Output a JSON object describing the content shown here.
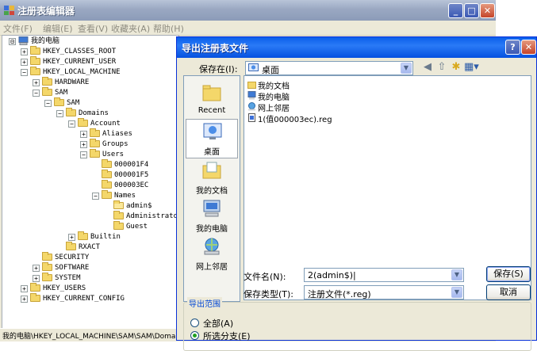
{
  "regedit": {
    "title": "注册表编辑器",
    "menu": [
      "文件(F)",
      "编辑(E)",
      "查看(V)",
      "收藏夹(A)",
      "帮助(H)"
    ],
    "status_path": "我的电脑\\HKEY_LOCAL_MACHINE\\SAM\\SAM\\Domains\\Ac",
    "tree": [
      {
        "label": "我的电脑",
        "depth": 0,
        "toggle": "⊟",
        "icon": "computer-icon"
      },
      {
        "label": "HKEY_CLASSES_ROOT",
        "depth": 1,
        "toggle": "+",
        "icon": "folder-icon"
      },
      {
        "label": "HKEY_CURRENT_USER",
        "depth": 1,
        "toggle": "+",
        "icon": "folder-icon"
      },
      {
        "label": "HKEY_LOCAL_MACHINE",
        "depth": 1,
        "toggle": "−",
        "icon": "folder-icon"
      },
      {
        "label": "HARDWARE",
        "depth": 2,
        "toggle": "+",
        "icon": "folder-icon"
      },
      {
        "label": "SAM",
        "depth": 2,
        "toggle": "−",
        "icon": "folder-icon"
      },
      {
        "label": "SAM",
        "depth": 3,
        "toggle": "−",
        "icon": "folder-icon"
      },
      {
        "label": "Domains",
        "depth": 4,
        "toggle": "−",
        "icon": "folder-icon"
      },
      {
        "label": "Account",
        "depth": 5,
        "toggle": "−",
        "icon": "folder-icon"
      },
      {
        "label": "Aliases",
        "depth": 6,
        "toggle": "+",
        "icon": "folder-icon"
      },
      {
        "label": "Groups",
        "depth": 6,
        "toggle": "+",
        "icon": "folder-icon"
      },
      {
        "label": "Users",
        "depth": 6,
        "toggle": "−",
        "icon": "folder-icon"
      },
      {
        "label": "000001F4",
        "depth": 7,
        "toggle": "",
        "icon": "folder-icon"
      },
      {
        "label": "000001F5",
        "depth": 7,
        "toggle": "",
        "icon": "folder-icon"
      },
      {
        "label": "000003EC",
        "depth": 7,
        "toggle": "",
        "icon": "folder-icon"
      },
      {
        "label": "Names",
        "depth": 7,
        "toggle": "−",
        "icon": "folder-icon"
      },
      {
        "label": "admin$",
        "depth": 8,
        "toggle": "",
        "icon": "folder-open-icon"
      },
      {
        "label": "Administrato",
        "depth": 8,
        "toggle": "",
        "icon": "folder-icon"
      },
      {
        "label": "Guest",
        "depth": 8,
        "toggle": "",
        "icon": "folder-icon"
      },
      {
        "label": "Builtin",
        "depth": 5,
        "toggle": "+",
        "icon": "folder-icon"
      },
      {
        "label": "RXACT",
        "depth": 4,
        "toggle": "",
        "icon": "folder-icon"
      },
      {
        "label": "SECURITY",
        "depth": 2,
        "toggle": "",
        "icon": "folder-icon"
      },
      {
        "label": "SOFTWARE",
        "depth": 2,
        "toggle": "+",
        "icon": "folder-icon"
      },
      {
        "label": "SYSTEM",
        "depth": 2,
        "toggle": "+",
        "icon": "folder-icon"
      },
      {
        "label": "HKEY_USERS",
        "depth": 1,
        "toggle": "+",
        "icon": "folder-icon"
      },
      {
        "label": "HKEY_CURRENT_CONFIG",
        "depth": 1,
        "toggle": "+",
        "icon": "folder-icon"
      }
    ]
  },
  "dialog": {
    "title": "导出注册表文件",
    "save_in_label": "保存在(I):",
    "save_in_value": "桌面",
    "places": [
      {
        "label": "Recent",
        "icon": "recent-folder-icon"
      },
      {
        "label": "桌面",
        "icon": "desktop-icon"
      },
      {
        "label": "我的文档",
        "icon": "my-documents-icon"
      },
      {
        "label": "我的电脑",
        "icon": "my-computer-icon"
      },
      {
        "label": "网上邻居",
        "icon": "network-icon"
      }
    ],
    "files": [
      {
        "label": "我的文档",
        "icon": "folder-icon"
      },
      {
        "label": "我的电脑",
        "icon": "computer-icon"
      },
      {
        "label": "网上邻居",
        "icon": "network-icon"
      },
      {
        "label": "1(值000003ec).reg",
        "icon": "reg-file-icon"
      }
    ],
    "filename_label": "文件名(N):",
    "filename_value": "2(admin$)|",
    "filetype_label": "保存类型(T):",
    "filetype_value": "注册文件(*.reg)",
    "save_button": "保存(S)",
    "cancel_button": "取消",
    "export_range_title": "导出范围",
    "radio_all": "全部(A)",
    "radio_branch": "所选分支(E)"
  },
  "colors": {
    "xp_blue": "#0a5fea",
    "regedit_inactive": "#9aa8c2",
    "dialog_bg": "#ece9d8"
  }
}
